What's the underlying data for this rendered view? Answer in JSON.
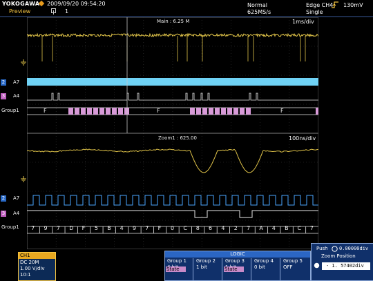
{
  "header": {
    "brand": "YOKOGAWA",
    "datetime": "2009/09/20 09:54:20",
    "mode_label": "Preview",
    "history_count": "1",
    "acq_mode": "Normal",
    "sample_rate": "625MS/s",
    "trigger_source": "Edge CH4",
    "trigger_level": "130mV",
    "trigger_mode": "Single"
  },
  "main_window": {
    "label": "Main : 6.25 M",
    "time_div": "1ms/div"
  },
  "zoom_window": {
    "label": "Zoom1 : 625.00",
    "time_div": "100ns/div"
  },
  "channels": {
    "main": [
      {
        "tag": "2",
        "name": "A7",
        "color": "#2a6ac8"
      },
      {
        "tag": "3",
        "name": "A4",
        "color": "#c060c0"
      },
      {
        "tag": "",
        "name": "Group1",
        "color": ""
      }
    ],
    "zoom": [
      {
        "tag": "2",
        "name": "A7",
        "color": "#2a6ac8"
      },
      {
        "tag": "3",
        "name": "A4",
        "color": "#c060c0"
      },
      {
        "tag": "",
        "name": "Group1",
        "color": ""
      }
    ]
  },
  "main_group_labels": [
    "F",
    "F",
    "F"
  ],
  "zoom_group_values": [
    "7",
    "9",
    "7",
    "D",
    "F",
    "5",
    "B",
    "4",
    "9",
    "7",
    "F",
    "0",
    "C",
    "8",
    "6",
    "4",
    "2",
    "7",
    "A",
    "4",
    "B",
    "C",
    "7"
  ],
  "ch1_panel": {
    "title": "CH1",
    "coupling": "DC 20M",
    "vdiv": "1.00 V/div",
    "probe": "10:1"
  },
  "logic_panel": {
    "title": "LOGIC",
    "groups": [
      {
        "name": "Group 1",
        "bits": "4 bit",
        "state": "State"
      },
      {
        "name": "Group 2",
        "bits": "1 bit",
        "state": ""
      },
      {
        "name": "Group 3",
        "bits": "1 bit",
        "state": "State"
      },
      {
        "name": "Group 4",
        "bits": "0 bit",
        "state": ""
      },
      {
        "name": "Group 5",
        "bits": "OFF",
        "state": ""
      }
    ]
  },
  "zoom_panel": {
    "push_label": "Push",
    "push_value": "0.00000div",
    "position_label": "Zoom Position",
    "position_value": "- 1. 57402div"
  },
  "colors": {
    "trace_yellow": "#e3c64a",
    "bus_blue": "#6fd2f5",
    "bus_pink": "#d89ad8",
    "digital_blue": "#4aa6ff",
    "digital_white": "#e8e8e8"
  }
}
